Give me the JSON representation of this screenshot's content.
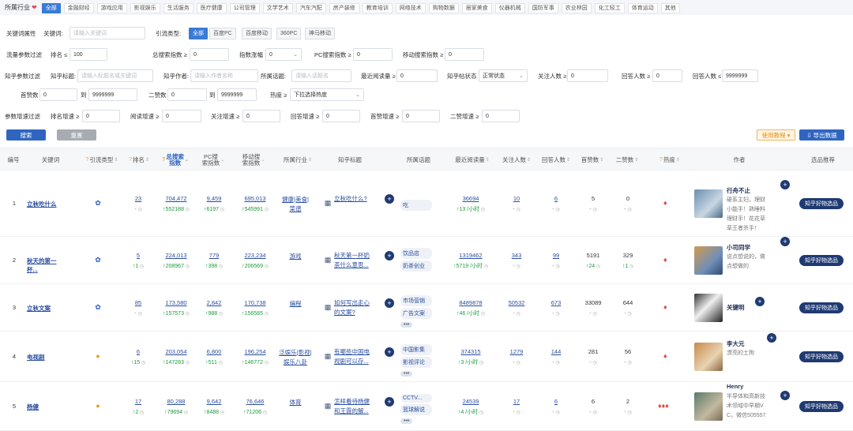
{
  "industry": {
    "label": "所属行业",
    "chips": [
      "全部",
      "金融财经",
      "游戏应用",
      "影视娱乐",
      "生活服务",
      "医疗健康",
      "公司管理",
      "文学艺术",
      "汽车汽配",
      "房产装修",
      "教育培训",
      "网络技术",
      "购物数据",
      "居家美食",
      "仪器机械",
      "国防军事",
      "农业林园",
      "化工轻工",
      "体育运动",
      "其他"
    ]
  },
  "filters": {
    "kw_attr_label": "关键词属性",
    "kw_label": "关键词:",
    "kw_placeholder": "请输入关键词",
    "traffic_type_label": "引流类型:",
    "traffic_types": [
      "全部",
      "百度PC",
      "百度移动",
      "360PC",
      "神马移动"
    ],
    "traffic_params_label": "流量参数过滤",
    "rank_label": "排名 ≤",
    "rank_value": "100",
    "total_index_label": "总搜索指数 ≥",
    "total_index_value": "0",
    "index_change_label": "指数涨幅",
    "index_change_value": "0",
    "pc_index_label": "PC搜索指数 ≥",
    "pc_index_value": "0",
    "mobile_index_label": "移动搜索指数 ≥",
    "mobile_index_value": "0",
    "zhihu_params_label": "知乎参数过滤",
    "zhihu_title_label": "知乎标题:",
    "zhihu_title_placeholder": "请输入标题名或关键词",
    "zhihu_author_label": "知乎作者:",
    "zhihu_author_placeholder": "请输入作者名称",
    "topic_label": "所属话题:",
    "topic_placeholder": "请输入话题名",
    "recent_read_label": "最近阅读量 ≥",
    "recent_read_value": "0",
    "post_status_label": "知乎帖状态",
    "post_status_value": "正常状态",
    "followers_label": "关注人数 ≥",
    "followers_value": "0",
    "answers_label": "回答人数 ≥",
    "answers_value": "0",
    "answers_max_label": "回答人数 ≤",
    "answers_max_value": "9999999",
    "likes_label": "首赞数",
    "likes_min": "0",
    "likes_to": "到",
    "likes_max": "9999999",
    "second_likes_label": "二赞数",
    "second_likes_min": "0",
    "second_likes_to": "到",
    "second_likes_max": "9999999",
    "heat_label": "热度 ≥",
    "heat_value": "下拉选择热度",
    "growth_params_label": "参数增速过滤",
    "rank_growth_label": "排名增速 ≥",
    "rank_growth_value": "0",
    "read_growth_label": "阅读增速 ≥",
    "read_growth_value": "0",
    "follow_growth_label": "关注增速 ≥",
    "follow_growth_value": "0",
    "answer_growth_label": "回答增速 ≥",
    "answer_growth_value": "0",
    "first_growth_label": "首赞增速 ≥",
    "first_growth_value": "0",
    "second_growth_label": "二赞增速 ≥",
    "second_growth_value": "0"
  },
  "buttons": {
    "search": "搜索",
    "reset": "重置",
    "tutorial": "使用教程",
    "export": "导出数据"
  },
  "headers": {
    "no": "编号",
    "kw": "关键词",
    "traffic": "引流类型",
    "rank": "排名",
    "total": [
      "总搜索",
      "指数"
    ],
    "pc": [
      "PC搜",
      "索指数"
    ],
    "mobile": [
      "移动搜",
      "索指数"
    ],
    "industry": "所属行业",
    "zhihu": "知乎标题",
    "topic": "所属话题",
    "recent": "最近阅读量",
    "follow": "关注人数",
    "answer": "回答人数",
    "first": "首赞数",
    "second": "二赞数",
    "heat": "热度",
    "author": "作者",
    "rec": "选品推荐"
  },
  "rows": [
    {
      "no": "1",
      "kw": "立秋吃什么",
      "rank": "23",
      "rank_inc": "- ",
      "total": "704,472",
      "total_inc": "↑552188",
      "pc": "9,459",
      "pc_inc": "↑6197",
      "mobile": "695,013",
      "mobile_inc": "↑545991",
      "industry": [
        "健康|美食|",
        "菜谱"
      ],
      "title": [
        "立秋吃什么?"
      ],
      "topics": [
        "吃"
      ],
      "recent": "36694",
      "recent_inc": "↑13 /小时",
      "follow": "10",
      "answer": "6",
      "first": "5",
      "second": "0",
      "author": "行舟不止",
      "desc": [
        "硬系主妇，理财",
        "小能手！熟睡料",
        "理财手！花花草",
        "草王者杀手！"
      ],
      "rec": "知乎好物选品"
    },
    {
      "no": "2",
      "kw": "秋天的第一杯...",
      "rank": "5",
      "rank_inc": "↑1",
      "total": "224,013",
      "total_inc": "↑208967",
      "pc": "779",
      "pc_inc": "↑398",
      "mobile": "223,234",
      "mobile_inc": "↑206569",
      "industry": [
        "游戏"
      ],
      "title": [
        "秋天第一杯奶",
        "茶什么意思..."
      ],
      "topics": [
        "饮品店",
        "奶茶创业"
      ],
      "recent": "1319462",
      "recent_inc": "↑5719 /小时",
      "follow": "343",
      "answer": "99",
      "first": "5191",
      "first_inc": "↑24",
      "second": "329",
      "second_inc": "↑1",
      "author": "小司同学",
      "desc": [
        "说点想说的，做",
        "点想做的"
      ],
      "rec": "知乎好物选品"
    },
    {
      "no": "3",
      "kw": "立秋文案",
      "rank": "85",
      "rank_inc": "- ",
      "total": "173,580",
      "total_inc": "↑157573",
      "pc": "2,842",
      "pc_inc": "↑988",
      "mobile": "170,738",
      "mobile_inc": "↑156585",
      "industry": [
        "编程"
      ],
      "title": [
        "如何写出走心",
        "的文案?"
      ],
      "topics": [
        "市场营销",
        "广告文案"
      ],
      "more": "•••",
      "recent": "8489878",
      "recent_inc": "↑46 /小时",
      "follow": "50532",
      "answer": "673",
      "first": "33089",
      "second": "644",
      "author": "关键明",
      "desc": [],
      "rec": "知乎好物选品"
    },
    {
      "no": "4",
      "kw": "电视剧",
      "rank": "6",
      "rank_inc": "↑15",
      "total": "203,054",
      "total_inc": "↑147283",
      "pc": "6,800",
      "pc_inc": "↑511",
      "mobile": "196,254",
      "mobile_inc": "↑146772",
      "industry": [
        "泛娱乐|影视|",
        "娱乐八卦"
      ],
      "title": [
        "有哪些中国电",
        "视剧可以存..."
      ],
      "topics": [
        "中国影集",
        "影视评论"
      ],
      "more": "•••",
      "recent": "374315",
      "recent_inc": "↑3 /小时",
      "follow": "1279",
      "answer": "144",
      "first": "281",
      "second": "56",
      "author": "李大元",
      "desc": [
        "漂亮的土狗"
      ],
      "rec": "知乎好物选品"
    },
    {
      "no": "5",
      "kw": "杨健",
      "rank": "17",
      "rank_inc": "↑2",
      "total": "80,288",
      "total_inc": "↑79694",
      "pc": "9,642",
      "pc_inc": "↑8488",
      "mobile": "76,646",
      "mobile_inc": "↑71206",
      "industry": [
        "体育"
      ],
      "title": [
        "怎样看待杨健",
        "和王霞的解..."
      ],
      "topics": [
        "CCTV...",
        "篮球解说"
      ],
      "more": "•••",
      "recent": "24539",
      "recent_inc": "↑4 /小时",
      "follow": "17",
      "answer": "6",
      "first": "6",
      "second": "2",
      "author": "Henry",
      "desc": [
        "半导体和高新技",
        "术领域中早期V",
        "C，微信505557"
      ],
      "rec": "知乎好物选品"
    }
  ]
}
